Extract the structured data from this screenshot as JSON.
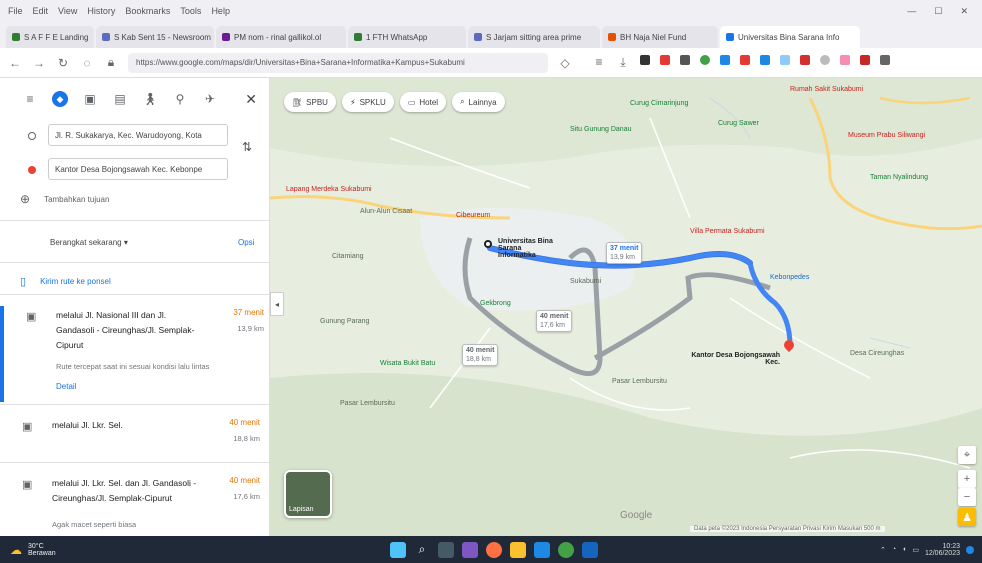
{
  "menubar": {
    "items": [
      "File",
      "Edit",
      "View",
      "History",
      "Bookmarks",
      "Tools",
      "Help"
    ]
  },
  "tabs": [
    {
      "label": "S A F F E Landing",
      "color": "#2e7d32"
    },
    {
      "label": "S Kab Sent 15 - Newsroom",
      "color": "#5c6bc0"
    },
    {
      "label": "PM nom - rinal gallikol.ol",
      "color": "#6a1b9a"
    },
    {
      "label": "1 FTH WhatsApp",
      "color": "#2e7d32"
    },
    {
      "label": "S Jarjam sitting area prime",
      "color": "#5c6bc0"
    },
    {
      "label": "BH Naja Niel Fund",
      "color": "#e65100"
    },
    {
      "label": "Universitas Bina Sarana Info",
      "color": "#1a73e8"
    }
  ],
  "url": {
    "value": "https://www.google.com/maps/dir/Universitas+Bina+Sarana+Informatika+Kampus+Sukabumi"
  },
  "directions": {
    "origin": "Jl. R. Sukakarya, Kec. Warudoyong, Kota",
    "destination": "Kantor Desa Bojongsawah Kec. Kebonpe",
    "add_destination": "Tambahkan tujuan",
    "depart_label": "Berangkat sekarang",
    "options_label": "Opsi",
    "send_label": "Kirim rute ke ponsel"
  },
  "routes": [
    {
      "name": "melalui Jl. Nasional III dan Jl. Gandasoli - Cireunghas/Jl. Semplak-Cipurut",
      "time": "37 menit",
      "distance": "13,9 km",
      "note": "Rute tercepat saat ini sesuai kondisi lalu lintas",
      "detail": "Detail"
    },
    {
      "name": "melalui Jl. Lkr. Sel.",
      "time": "40 menit",
      "distance": "18,8 km"
    },
    {
      "name": "melalui Jl. Lkr. Sel. dan Jl. Gandasoli - Cireunghas/Jl. Semplak-Cipurut",
      "time": "40 menit",
      "distance": "17,6 km",
      "note": "Agak macet seperti biasa"
    }
  ],
  "chips": [
    "SPBU",
    "SPKLU",
    "Hotel",
    "Lainnya"
  ],
  "map_labels": {
    "hospital": "Rumah Sakit Sukabumi",
    "origin": "Universitas Bina Sarana Informatika",
    "city": "Sukabumi",
    "destination": "Kantor Desa Bojongsawah Kec.",
    "dest_hotel": "Villa Permata Sukabumi",
    "waterfall": "Curug Cimarinjung",
    "park": "Situ Gunung Danau",
    "alun": "Alun-Alun Cisaat",
    "museum": "Museum Prabu Siliwangi",
    "lapang": "Lapang Merdeka Sukabumi",
    "cibeureum": "Cibeureum",
    "curug_sawer": "Curug Sawer",
    "cireunghas": "Desa Cireunghas",
    "lembursitu": "Pasar Lembursitu",
    "pelabuhan": "Gunung Parang",
    "gekbrong": "Gekbrong",
    "citamiang": "Citamiang",
    "nyalindung": "Taman Nyalindung",
    "walungan": "Wisata Bukit Batu",
    "kebonpedes": "Kebonpedes"
  },
  "map_bubbles": [
    {
      "time": "37 menit",
      "distance": "13,9 km"
    },
    {
      "time": "40 menit",
      "distance": "17,6 km"
    },
    {
      "time": "40 menit",
      "distance": "18,8 km"
    }
  ],
  "layers_label": "Lapisan",
  "footer": "Data peta ©2023  Indonesia  Persyaratan  Privasi  Kirim Masukan  500 m",
  "google_logo": "Google",
  "taskbar": {
    "temp": "30°C",
    "condition": "Berawan",
    "time": "10:23",
    "date": "12/06/2023"
  },
  "colors": {
    "route_main": "#4285f4",
    "route_alt": "#9aa0a6",
    "map_bg": "#e8eedf",
    "major_road": "#f9d47a"
  }
}
